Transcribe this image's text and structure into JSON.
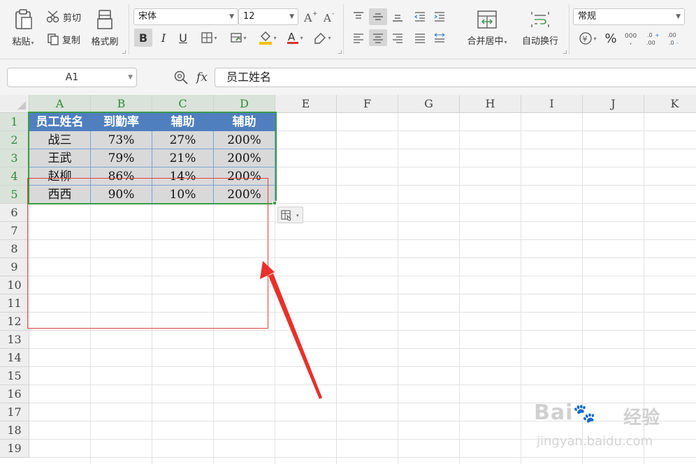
{
  "ribbon": {
    "paste_label": "粘贴",
    "cut_label": "剪切",
    "copy_label": "复制",
    "format_painter_label": "格式刷",
    "font_name": "宋体",
    "font_size": "12",
    "bold_label": "B",
    "italic_label": "I",
    "underline_label": "U",
    "merge_center_label": "合并居中",
    "wrap_text_label": "自动换行",
    "number_format": "常规",
    "font_color": "#e0302a",
    "fill_color": "#f2c200"
  },
  "formula_bar": {
    "name_box": "A1",
    "fx_label": "fx",
    "content": "员工姓名"
  },
  "grid": {
    "columns": [
      "A",
      "B",
      "C",
      "D",
      "E",
      "F",
      "G",
      "H",
      "I",
      "J",
      "K"
    ],
    "rows": [
      "1",
      "2",
      "3",
      "4",
      "5",
      "6",
      "7",
      "8",
      "9",
      "10",
      "11",
      "12",
      "13",
      "14",
      "15",
      "16",
      "17",
      "18",
      "19"
    ],
    "selected_columns": [
      "A",
      "B",
      "C",
      "D"
    ],
    "selected_rows": [
      "1",
      "2",
      "3",
      "4",
      "5"
    ]
  },
  "table": {
    "headers": [
      "员工姓名",
      "到勤率",
      "辅助",
      "辅助"
    ],
    "rows": [
      [
        "战三",
        "73%",
        "27%",
        "200%"
      ],
      [
        "王武",
        "79%",
        "21%",
        "200%"
      ],
      [
        "赵柳",
        "86%",
        "14%",
        "200%"
      ],
      [
        "西西",
        "90%",
        "10%",
        "200%"
      ]
    ],
    "header_color": "#4f7fbf",
    "cell_color": "#d9d9d9"
  },
  "annotation": {
    "box_color": "#e0413a",
    "arrow_color": "#e8302a"
  },
  "watermark": {
    "brand": "Bai",
    "brand2": "经验",
    "url": "jingyan.baidu.com"
  }
}
